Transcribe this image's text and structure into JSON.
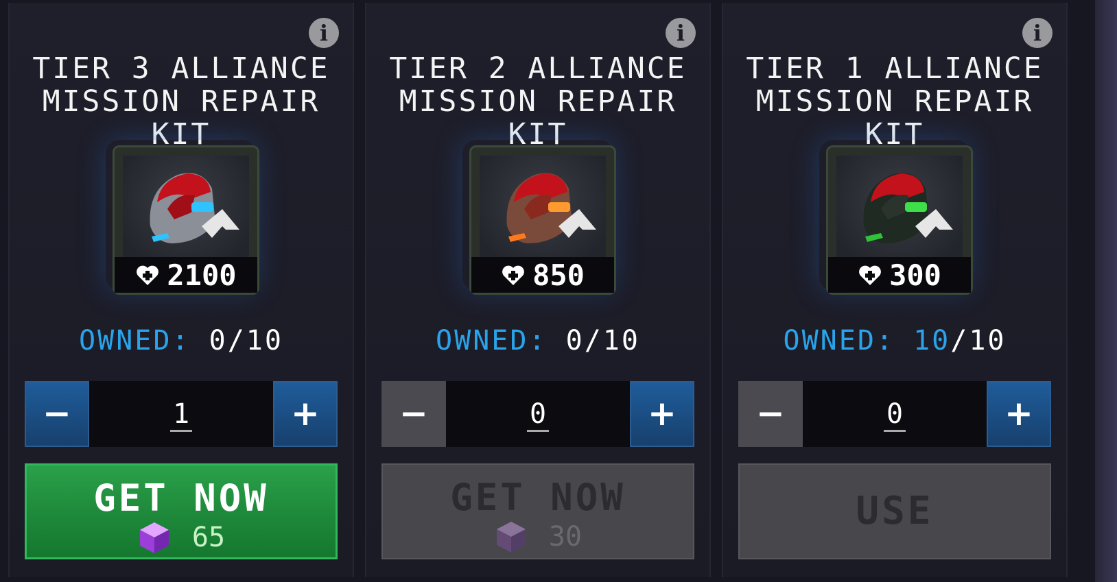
{
  "cards": [
    {
      "title_line1": "TIER 3 ALLIANCE",
      "title_line2": "MISSION REPAIR KIT",
      "hp": "2100",
      "owned_label": "OWNED:",
      "owned_value": "0",
      "owned_max": "/10",
      "stepper_value": "1",
      "minus": "−",
      "plus": "+",
      "action_label": "GET NOW",
      "cost": "65",
      "accent_color": "#2ec3ff"
    },
    {
      "title_line1": "TIER 2 ALLIANCE",
      "title_line2": "MISSION REPAIR KIT",
      "hp": "850",
      "owned_label": "OWNED:",
      "owned_value": "0",
      "owned_max": "/10",
      "stepper_value": "0",
      "minus": "−",
      "plus": "+",
      "action_label": "GET NOW",
      "cost": "30",
      "accent_color": "#ff9a2e"
    },
    {
      "title_line1": "TIER 1 ALLIANCE",
      "title_line2": "MISSION REPAIR KIT",
      "hp": "300",
      "owned_label": "OWNED:",
      "owned_value": "10",
      "owned_max": "/10",
      "stepper_value": "0",
      "minus": "−",
      "plus": "+",
      "action_label": "USE",
      "accent_color": "#3ee04a"
    }
  ],
  "info_glyph": "i",
  "colors": {
    "owned_label": "#2aa3ea",
    "get_now_green": "#1f8a3b",
    "disabled_grey": "#47474c",
    "stepper_blue": "#1f5c9a"
  }
}
